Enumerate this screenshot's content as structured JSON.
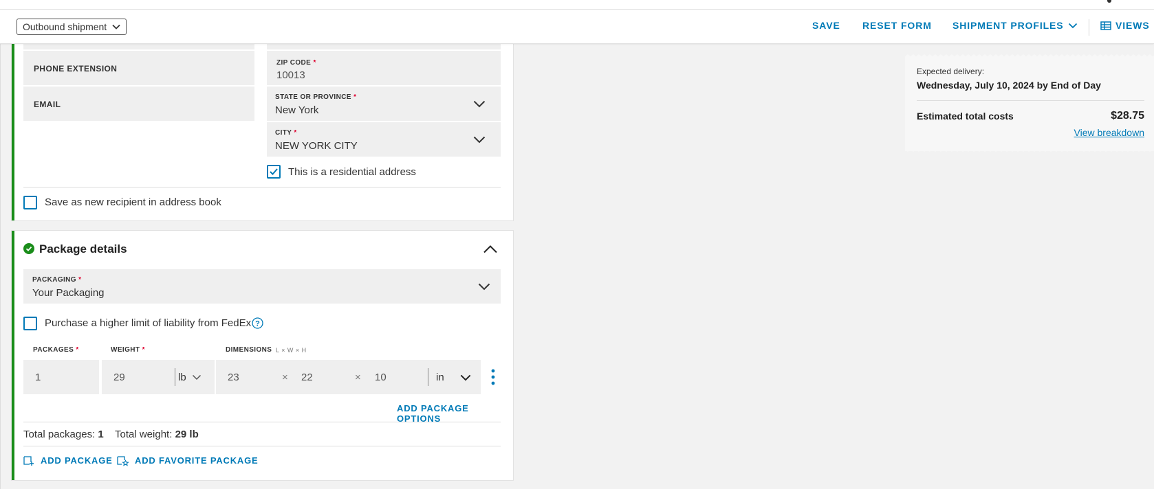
{
  "toolbar": {
    "shipment_type": "Outbound shipment",
    "save": "SAVE",
    "reset": "RESET FORM",
    "profiles": "SHIPMENT PROFILES",
    "views": "VIEWS"
  },
  "recipient": {
    "phone_extension_label": "PHONE EXTENSION",
    "email_label": "EMAIL",
    "zip_label": "ZIP CODE",
    "zip_value": "10013",
    "state_label": "STATE OR PROVINCE",
    "state_value": "New York",
    "city_label": "CITY",
    "city_value": "NEW YORK CITY",
    "residential_label": "This is a residential address",
    "save_recipient_label": "Save as new recipient in address book"
  },
  "package": {
    "title": "Package details",
    "packaging_label": "PACKAGING",
    "packaging_value": "Your Packaging",
    "liability_label": "Purchase a higher limit of liability from FedEx",
    "packages_label": "PACKAGES",
    "weight_label": "WEIGHT",
    "dimensions_label": "DIMENSIONS",
    "dimensions_hint": "L × W × H",
    "packages_value": "1",
    "weight_value": "29",
    "weight_unit": "lb",
    "length": "23",
    "width": "22",
    "height": "10",
    "dim_unit": "in",
    "times": "×",
    "add_options": "ADD PACKAGE OPTIONS",
    "total_packages_label": "Total packages:",
    "total_packages_value": "1",
    "total_weight_label": "Total weight:",
    "total_weight_value": "29 lb",
    "add_package": "ADD PACKAGE",
    "add_favorite": "ADD FAVORITE PACKAGE"
  },
  "summary": {
    "expected_label": "Expected delivery:",
    "expected_value": "Wednesday, July 10, 2024 by End of Day",
    "costs_label": "Estimated total costs",
    "costs_value": "$28.75",
    "breakdown_link": "View breakdown"
  },
  "colors": {
    "accent": "#007ab7",
    "success": "#1a8d1a",
    "required": "#de002e"
  }
}
